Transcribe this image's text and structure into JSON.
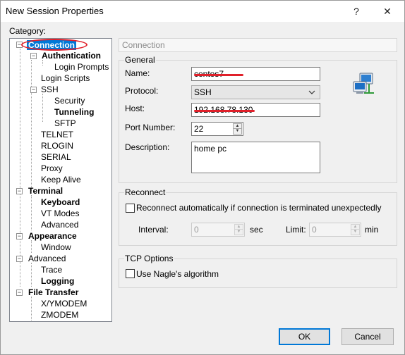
{
  "window": {
    "title": "New Session Properties",
    "help_glyph": "?",
    "close_glyph": "✕"
  },
  "category_label": "Category:",
  "tree": {
    "expand_glyph": "−",
    "items": [
      {
        "label": "Connection",
        "selected": true
      },
      {
        "label": "Authentication"
      },
      {
        "label": "Login Prompts"
      },
      {
        "label": "Login Scripts"
      },
      {
        "label": "SSH"
      },
      {
        "label": "Security"
      },
      {
        "label": "Tunneling"
      },
      {
        "label": "SFTP"
      },
      {
        "label": "TELNET"
      },
      {
        "label": "RLOGIN"
      },
      {
        "label": "SERIAL"
      },
      {
        "label": "Proxy"
      },
      {
        "label": "Keep Alive"
      },
      {
        "label": "Terminal"
      },
      {
        "label": "Keyboard"
      },
      {
        "label": "VT Modes"
      },
      {
        "label": "Advanced"
      },
      {
        "label": "Appearance"
      },
      {
        "label": "Window"
      },
      {
        "label": "Advanced"
      },
      {
        "label": "Trace"
      },
      {
        "label": "Logging"
      },
      {
        "label": "File Transfer"
      },
      {
        "label": "X/YMODEM"
      },
      {
        "label": "ZMODEM"
      }
    ]
  },
  "panel": {
    "header": "Connection"
  },
  "general": {
    "title": "General",
    "name_label": "Name:",
    "name_value": "centos7",
    "protocol_label": "Protocol:",
    "protocol_value": "SSH",
    "host_label": "Host:",
    "host_value": "192.168.78.130",
    "port_label": "Port Number:",
    "port_value": "22",
    "description_label": "Description:",
    "description_value": "home pc",
    "icon": "network-computer-icon"
  },
  "reconnect": {
    "title": "Reconnect",
    "checkbox_label": "Reconnect automatically if connection is terminated unexpectedly",
    "checked": false,
    "interval_label": "Interval:",
    "interval_value": "0",
    "interval_unit": "sec",
    "limit_label": "Limit:",
    "limit_value": "0",
    "limit_unit": "min"
  },
  "tcp": {
    "title": "TCP Options",
    "nagle_label": "Use Nagle's algorithm",
    "checked": false
  },
  "buttons": {
    "ok": "OK",
    "cancel": "Cancel"
  },
  "colors": {
    "selection": "#0078d7",
    "redaction": "#e0202a"
  }
}
